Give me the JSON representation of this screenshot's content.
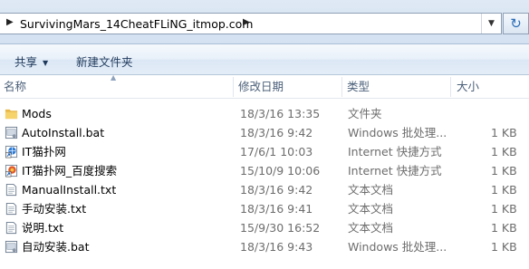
{
  "address": {
    "path": "SurvivingMars_14CheatFLiNG_itmop.com",
    "refresh_icon": "refresh-icon"
  },
  "toolbar": {
    "share": "共享",
    "new_folder": "新建文件夹"
  },
  "columns": {
    "name": "名称",
    "date": "修改日期",
    "type": "类型",
    "size": "大小"
  },
  "files": [
    {
      "name": "Mods",
      "date": "18/3/16 13:35",
      "type": "文件夹",
      "size": "",
      "icon": "folder-icon"
    },
    {
      "name": "AutoInstall.bat",
      "date": "18/3/16 9:42",
      "type": "Windows 批处理...",
      "size": "1 KB",
      "icon": "batch-file-icon"
    },
    {
      "name": "IT猫扑网",
      "date": "17/6/1 10:03",
      "type": "Internet 快捷方式",
      "size": "1 KB",
      "icon": "internet-shortcut-icon"
    },
    {
      "name": "IT猫扑网_百度搜索",
      "date": "15/10/9 10:06",
      "type": "Internet 快捷方式",
      "size": "1 KB",
      "icon": "internet-shortcut-icon"
    },
    {
      "name": "ManualInstall.txt",
      "date": "18/3/16 9:42",
      "type": "文本文档",
      "size": "1 KB",
      "icon": "text-file-icon"
    },
    {
      "name": "手动安装.txt",
      "date": "18/3/16 9:41",
      "type": "文本文档",
      "size": "1 KB",
      "icon": "text-file-icon"
    },
    {
      "name": "说明.txt",
      "date": "15/9/30 16:52",
      "type": "文本文档",
      "size": "1 KB",
      "icon": "text-file-icon"
    },
    {
      "name": "自动安装.bat",
      "date": "18/3/16 9:43",
      "type": "Windows 批处理...",
      "size": "1 KB",
      "icon": "batch-file-icon"
    }
  ]
}
